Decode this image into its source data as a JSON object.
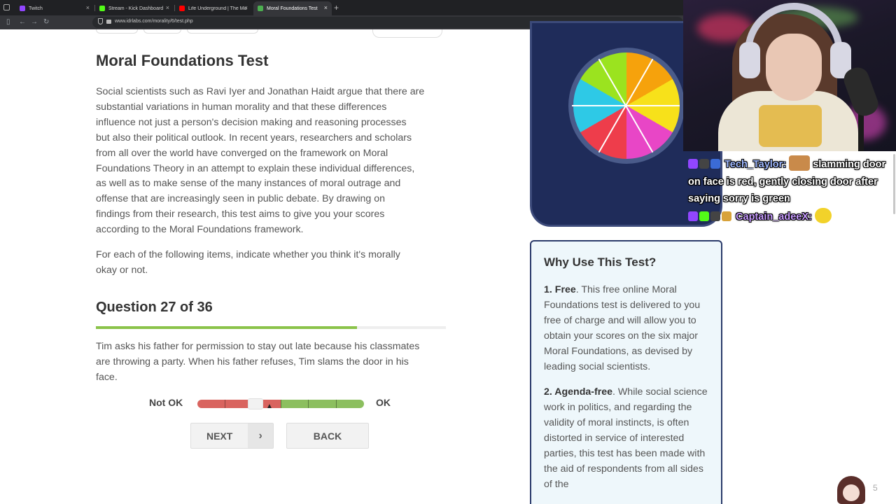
{
  "browser": {
    "tabs": [
      {
        "label": "Twitch",
        "color": "#9146ff"
      },
      {
        "label": "Stream - Kick Dashboard",
        "color": "#53fc18"
      },
      {
        "label": "Life Underground | The Mole P...",
        "color": "#ff0000"
      },
      {
        "label": "Moral Foundations Test",
        "color": "#4caf50"
      }
    ],
    "new_tab": "+",
    "close": "×",
    "url": "www.idrlabs.com/morality/6/test.php"
  },
  "page": {
    "title": "Moral Foundations Test",
    "intro_lines": [
      "Social scientists such as Ravi Iyer and Jonathan Haidt argue that there are",
      "substantial variations in human morality and that these differences",
      "influence not just a person's decision making and reasoning processes",
      "but also their political outlook. In recent years, researchers and scholars",
      "from all over the world have converged on the framework on Moral",
      "Foundations Theory in an attempt to explain these individual differences,",
      "as well as to make sense of the many instances of moral outrage and",
      "offense that are increasingly seen in public debate. By drawing on",
      "findings from their research, this test aims to give you your scores",
      "according to the Moral Foundations framework."
    ],
    "instruction_lines": [
      "For each of the following items, indicate whether you think it's morally",
      "okay or not."
    ],
    "question_heading": "Question 27 of 36",
    "progress_fraction": 0.746,
    "question_lines": [
      "Tim asks his father for permission to stay out late because his classmates",
      "are throwing a party. When his father refuses, Tim slams the door in his",
      "face."
    ],
    "scale_left": "Not OK",
    "scale_right": "OK",
    "scale_colors": {
      "negative": "#d9645f",
      "positive": "#8cbf5f"
    },
    "slider_value_fraction": 0.35,
    "next_label": "NEXT",
    "next_chevron": "›",
    "back_label": "BACK"
  },
  "sidebar": {
    "why_title": "Why Use This Test?",
    "points": [
      {
        "number": "1. Free",
        "text": ". This free online Moral Foundations test is delivered to you free of charge and will allow you to obtain your scores on the six major Moral Foundations, as devised by leading social scientists."
      },
      {
        "number": "2. Agenda-free",
        "text": ". While social science work in politics, and regarding the validity of moral instincts, is often distorted in service of interested parties, this test has been made with the aid of respondents from all sides of the"
      }
    ]
  },
  "stream_overlay": {
    "chat": [
      {
        "user": "Tech_Taylor:",
        "message": "slamming door on face is red, gently closing door after saying sorry is green"
      },
      {
        "user": "Captain_adeeX:",
        "message": ""
      }
    ],
    "viewer_count": "5"
  }
}
